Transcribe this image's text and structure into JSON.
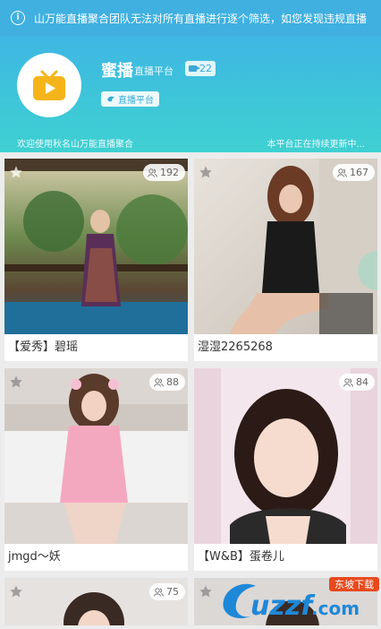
{
  "notice": {
    "icon": "info-icon",
    "text": "山万能直播聚合团队无法对所有直播进行逐个筛选，如您发现违规直播"
  },
  "header": {
    "title": "蜜播",
    "subtitle": "直播平台",
    "count": "22",
    "platform_label": "直播平台",
    "welcome": "欢迎使用秋名山万能直播聚合",
    "updating": "本平台正在持续更新中..."
  },
  "cards": [
    {
      "name": "【爱秀】碧瑶",
      "viewers": "192"
    },
    {
      "name": "湿湿2265268",
      "viewers": "167"
    },
    {
      "name": "jmgd～妖",
      "viewers": "88"
    },
    {
      "name": "【W&B】蛋卷儿",
      "viewers": "84"
    },
    {
      "name": "",
      "viewers": "75"
    },
    {
      "name": "",
      "viewers": ""
    }
  ],
  "watermark": {
    "brand": "uzzf.com",
    "tagline": "东坡下载"
  },
  "colors": {
    "accent": "#3fb0e0",
    "header_end": "#3fd0d2",
    "logo": "#f5b51a"
  }
}
